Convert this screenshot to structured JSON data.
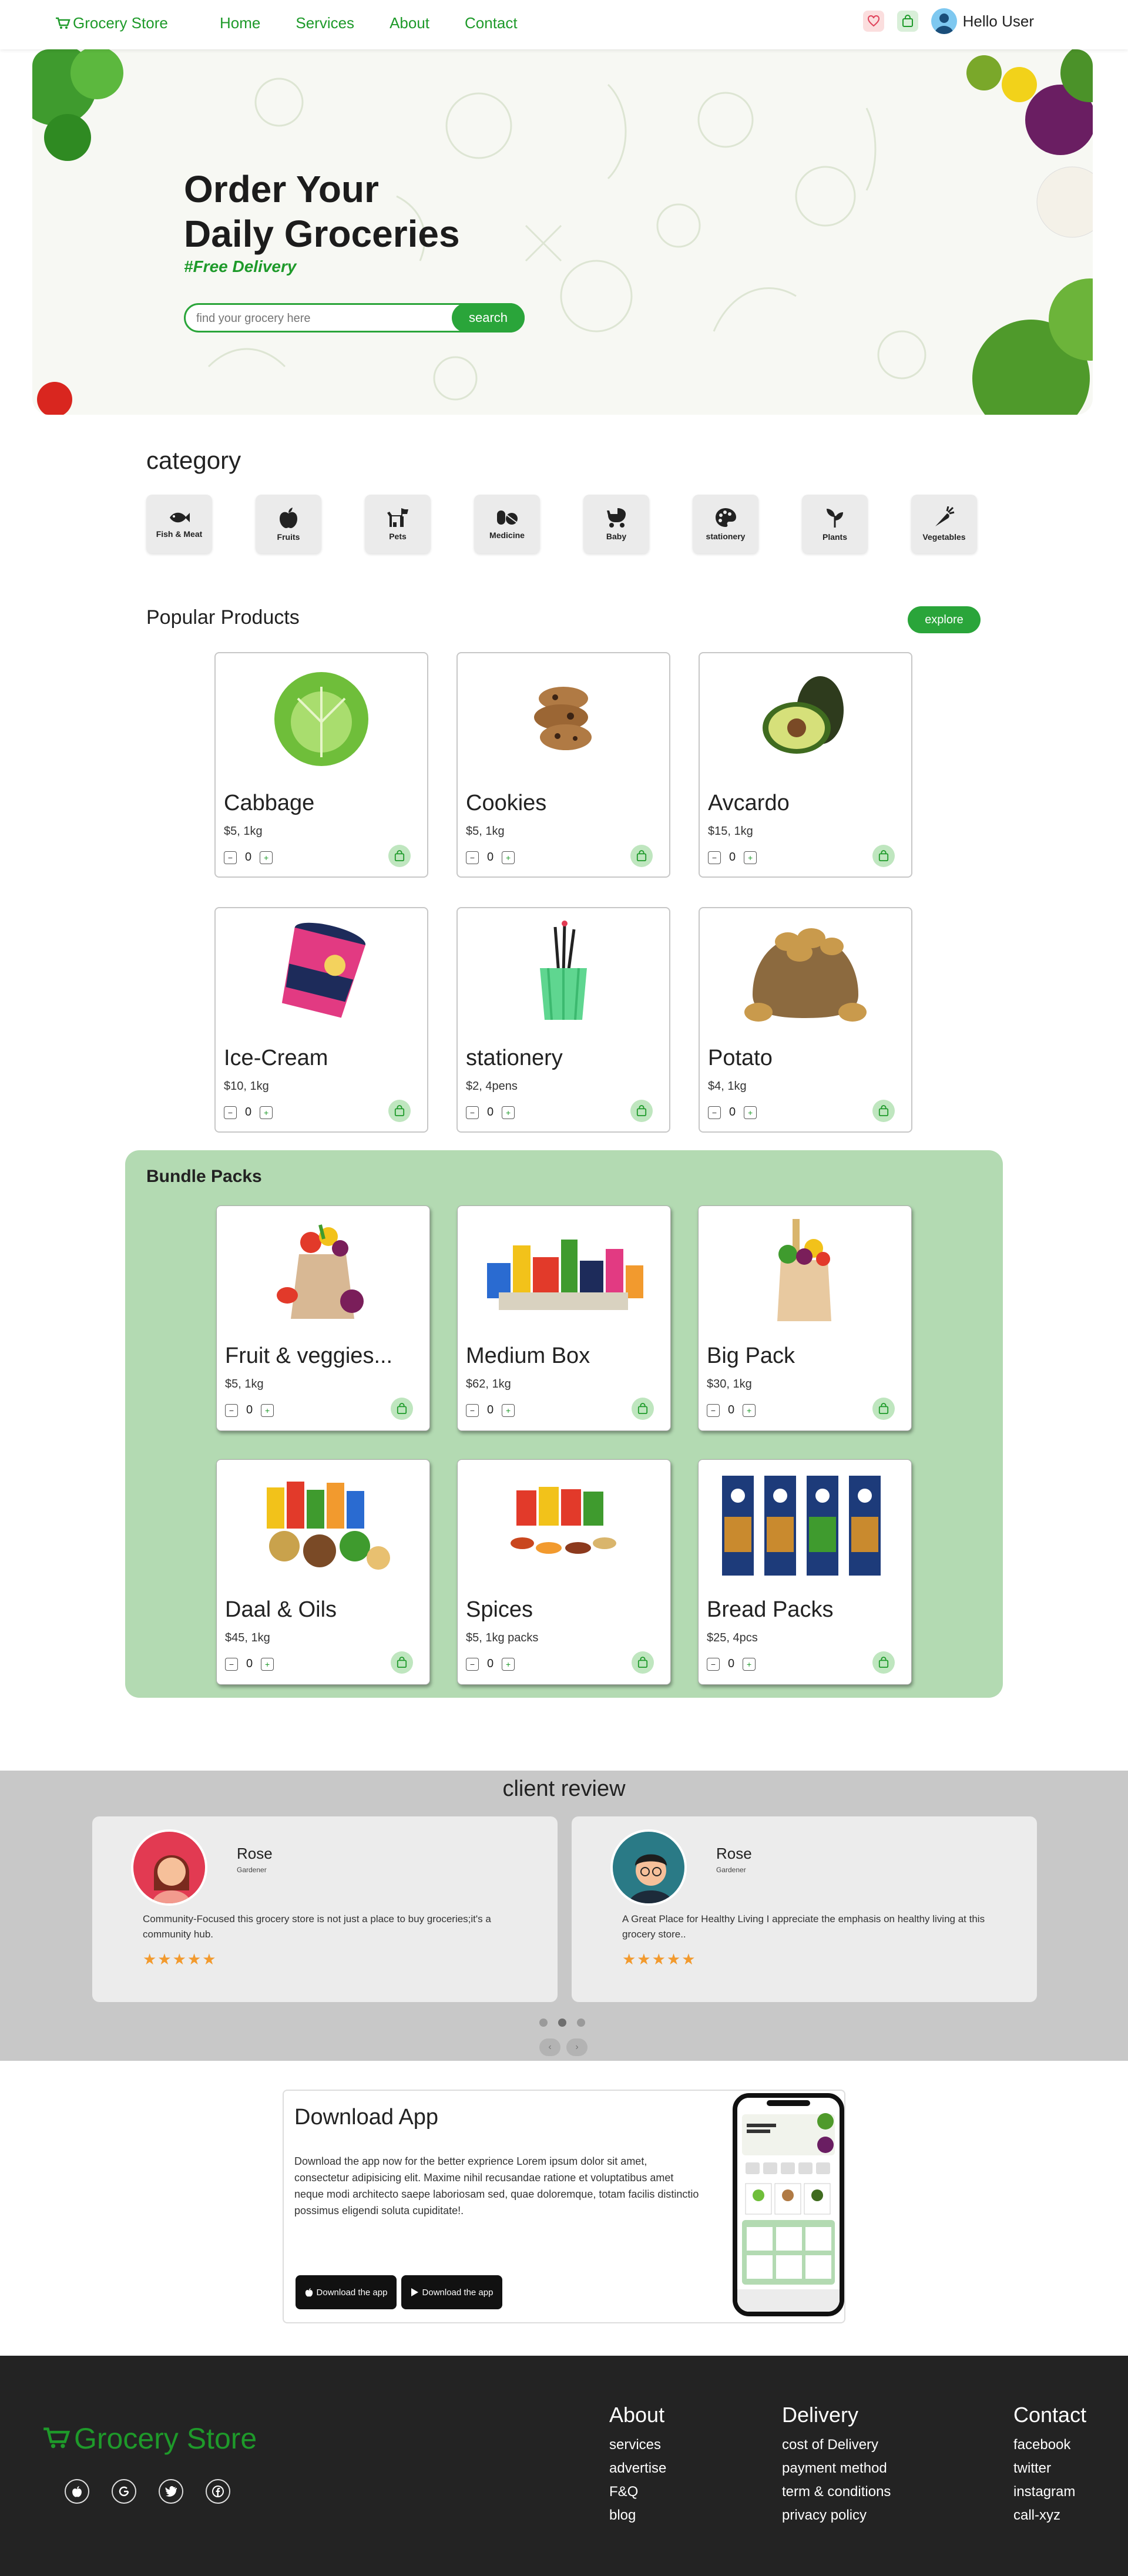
{
  "nav": {
    "logo": "Grocery Store",
    "links": [
      "Home",
      "Services",
      "About",
      "Contact"
    ],
    "user": "Hello User",
    "accent": "#1e9a2a"
  },
  "hero": {
    "title_line1": "Order Your",
    "title_line2": "Daily Groceries",
    "tagline": "#Free Delivery",
    "search_placeholder": "find your grocery here",
    "search_button": "search"
  },
  "categories": {
    "title": "category",
    "items": [
      {
        "label": "Fish & Meat",
        "icon": "fish-icon"
      },
      {
        "label": "Fruits",
        "icon": "apple-icon"
      },
      {
        "label": "Pets",
        "icon": "dog-icon"
      },
      {
        "label": "Medicine",
        "icon": "pills-icon"
      },
      {
        "label": "Baby",
        "icon": "baby-carriage-icon"
      },
      {
        "label": "stationery",
        "icon": "palette-icon"
      },
      {
        "label": "Plants",
        "icon": "seedling-icon"
      },
      {
        "label": "Vegetables",
        "icon": "carrot-icon"
      }
    ]
  },
  "popular": {
    "title": "Popular Products",
    "explore": "explore",
    "products": [
      {
        "name": "Cabbage",
        "price": "$5, 1kg",
        "qty": "0"
      },
      {
        "name": "Cookies",
        "price": "$5, 1kg",
        "qty": "0"
      },
      {
        "name": "Avcardo",
        "price": "$15, 1kg",
        "qty": "0"
      },
      {
        "name": "Ice-Cream",
        "price": "$10, 1kg",
        "qty": "0"
      },
      {
        "name": "stationery",
        "price": "$2, 4pens",
        "qty": "0"
      },
      {
        "name": "Potato",
        "price": "$4, 1kg",
        "qty": "0"
      }
    ]
  },
  "bundles": {
    "title": "Bundle Packs",
    "products": [
      {
        "name": "Fruit & veggies...",
        "price": "$5, 1kg",
        "qty": "0"
      },
      {
        "name": "Medium Box",
        "price": "$62, 1kg",
        "qty": "0"
      },
      {
        "name": "Big Pack",
        "price": "$30, 1kg",
        "qty": "0"
      },
      {
        "name": "Daal & Oils",
        "price": "$45, 1kg",
        "qty": "0"
      },
      {
        "name": "Spices",
        "price": "$5, 1kg packs",
        "qty": "0"
      },
      {
        "name": "Bread Packs",
        "price": "$25, 4pcs",
        "qty": "0"
      }
    ]
  },
  "reviews": {
    "title": "client review",
    "items": [
      {
        "name": "Rose",
        "role": "Gardener",
        "text": "Community-Focused this grocery store is not just a place to buy groceries;it's a community hub.",
        "stars": "★★★★★"
      },
      {
        "name": "Rose",
        "role": "Gardener",
        "text": "A Great Place for Healthy Living I appreciate the emphasis on healthy living at this grocery store..",
        "stars": "★★★★★"
      }
    ]
  },
  "download": {
    "title": "Download App",
    "text": "Download the app now for the better exprience Lorem ipsum dolor sit amet, consectetur adipisicing elit. Maxime nihil recusandae ratione et voluptatibus amet neque modi architecto saepe laboriosam sed, quae doloremque, totam facilis distinctio possimus eligendi soluta cupiditate!.",
    "apple_button": "Download the app",
    "play_button": "Download the app"
  },
  "footer": {
    "logo": "Grocery Store",
    "about": {
      "title": "About",
      "links": [
        "services",
        "advertise",
        "F&Q",
        "blog"
      ]
    },
    "delivery": {
      "title": "Delivery",
      "links": [
        "cost of Delivery",
        "payment method",
        "term & conditions",
        "privacy policy"
      ]
    },
    "contact": {
      "title": "Contact",
      "links": [
        "facebook",
        "twitter",
        "instagram",
        "call-xyz"
      ]
    }
  }
}
